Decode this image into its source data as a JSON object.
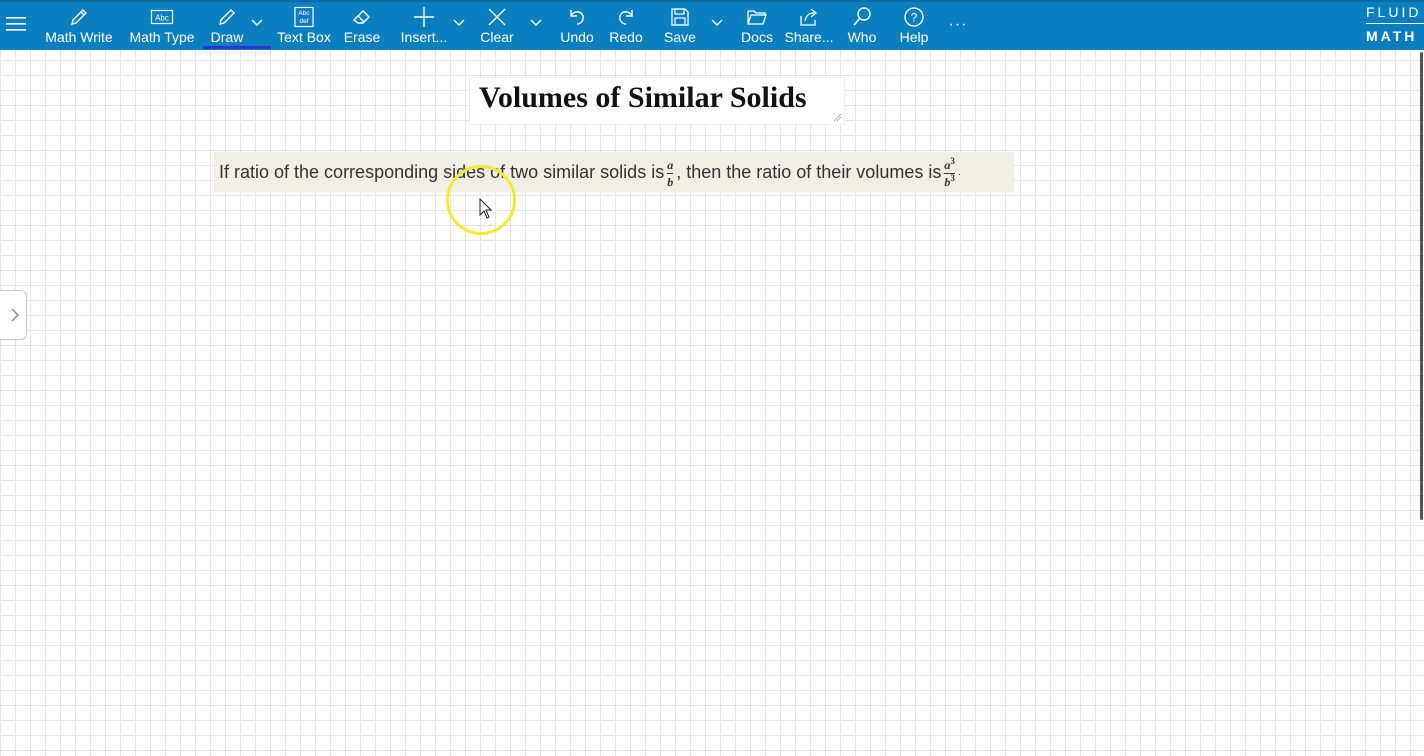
{
  "toolbar": {
    "items": [
      {
        "label": "Math Write",
        "icon": "pencil-icon"
      },
      {
        "label": "Math Type",
        "icon": "abc-box-icon"
      },
      {
        "label": "Draw",
        "icon": "pen-icon",
        "active": true
      },
      {
        "label": "Text Box",
        "icon": "text-box-icon"
      },
      {
        "label": "Erase",
        "icon": "eraser-icon"
      },
      {
        "label": "Insert...",
        "icon": "plus-icon"
      },
      {
        "label": "Clear",
        "icon": "x-icon"
      },
      {
        "label": "Undo",
        "icon": "undo-icon"
      },
      {
        "label": "Redo",
        "icon": "redo-icon"
      },
      {
        "label": "Save",
        "icon": "floppy-disk-icon"
      },
      {
        "label": "Docs",
        "icon": "folder-icon"
      },
      {
        "label": "Share...",
        "icon": "share-icon"
      },
      {
        "label": "Who",
        "icon": "search-icon"
      },
      {
        "label": "Help",
        "icon": "help-icon"
      }
    ],
    "more": "···",
    "brand_top": "FLUID",
    "brand_bottom": "MATH",
    "bar_color": "#0a7fbf",
    "active_underline_color": "#2a35d6"
  },
  "canvas": {
    "title": "Volumes of Similar Solids",
    "note": {
      "part1": "If ratio of the corresponding sides of two similar solids is",
      "frac1_num": "a",
      "frac1_den": "b",
      "part2": ", then the ratio of their volumes is",
      "frac2_num": "a",
      "frac2_num_exp": "3",
      "frac2_den": "b",
      "frac2_den_exp": "3",
      "part3": "."
    },
    "highlight_color": "#f4ea35"
  }
}
